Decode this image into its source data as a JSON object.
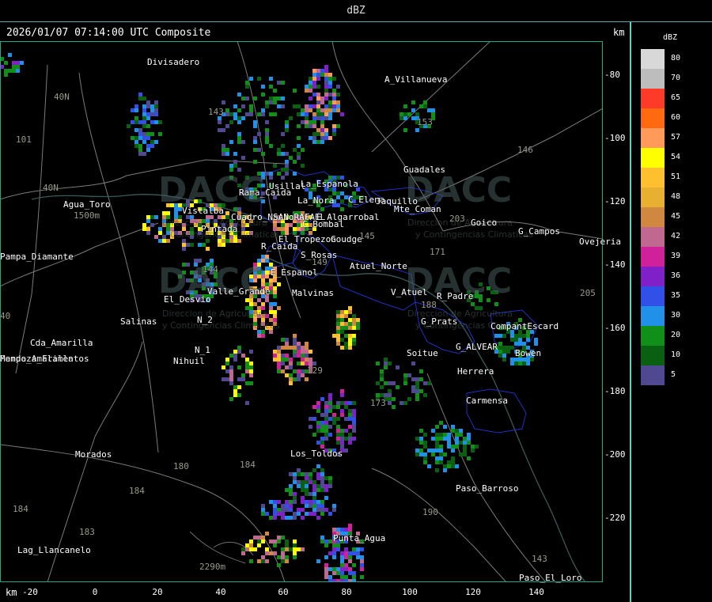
{
  "window": {
    "title": "dBZ"
  },
  "header": {
    "timestamp": "2026/01/07 07:14:00 UTC Composite",
    "unit_right": "km",
    "unit_bottom": "km"
  },
  "axes": {
    "y_ticks": [
      "-80",
      "-100",
      "-120",
      "-140",
      "-160",
      "-180",
      "-200",
      "-220"
    ],
    "x_ticks": [
      "-20",
      "0",
      "20",
      "40",
      "60",
      "80",
      "100",
      "120",
      "140"
    ]
  },
  "legend": {
    "title": "dBZ",
    "entries": [
      {
        "value": "80",
        "color": "#d8d8d8"
      },
      {
        "value": "70",
        "color": "#bdbdbd"
      },
      {
        "value": "65",
        "color": "#ff3a28"
      },
      {
        "value": "60",
        "color": "#ff6a10"
      },
      {
        "value": "57",
        "color": "#ff9a5a"
      },
      {
        "value": "54",
        "color": "#ffff00"
      },
      {
        "value": "51",
        "color": "#ffc030"
      },
      {
        "value": "48",
        "color": "#e8b030"
      },
      {
        "value": "45",
        "color": "#d08840"
      },
      {
        "value": "42",
        "color": "#c06890"
      },
      {
        "value": "39",
        "color": "#d0209a"
      },
      {
        "value": "36",
        "color": "#8020c8"
      },
      {
        "value": "35",
        "color": "#3050e8"
      },
      {
        "value": "30",
        "color": "#2090e8"
      },
      {
        "value": "20",
        "color": "#109018"
      },
      {
        "value": "10",
        "color": "#086010"
      },
      {
        "value": "5",
        "color": "#504890"
      }
    ]
  },
  "places": [
    {
      "name": "Divisadero",
      "dim": false
    },
    {
      "name": "A_Villanueva",
      "dim": false
    },
    {
      "name": "Guadales",
      "dim": false
    },
    {
      "name": "Vistalba",
      "dim": false
    },
    {
      "name": "Usillal",
      "dim": false
    },
    {
      "name": "La_Espanola",
      "dim": false
    },
    {
      "name": "C_Elena",
      "dim": false
    },
    {
      "name": "Jaquillo",
      "dim": false
    },
    {
      "name": "Mte_Coman",
      "dim": false
    },
    {
      "name": "Agua_Toro",
      "dim": false
    },
    {
      "name": "1500m",
      "dim": true
    },
    {
      "name": "Rama_Caida",
      "dim": false
    },
    {
      "name": "Cuadro_Nacional",
      "dim": false
    },
    {
      "name": "La_Nora",
      "dim": false
    },
    {
      "name": "SAN RAFAEL",
      "dim": false
    },
    {
      "name": "E_Algarrobal",
      "dim": false
    },
    {
      "name": "C_Bombal",
      "dim": false
    },
    {
      "name": "Goico",
      "dim": false
    },
    {
      "name": "G_Campos",
      "dim": false
    },
    {
      "name": "Ovejeria",
      "dim": false
    },
    {
      "name": "Pintada",
      "dim": false
    },
    {
      "name": "El_Tropezon",
      "dim": false
    },
    {
      "name": "Goudge",
      "dim": false
    },
    {
      "name": "Pampa_Diamante",
      "dim": false
    },
    {
      "name": "Pampa_Amarilla",
      "dim": false
    },
    {
      "name": "R_Caida",
      "dim": false
    },
    {
      "name": "S_Rosas",
      "dim": false
    },
    {
      "name": "Atuel_Norte",
      "dim": false
    },
    {
      "name": "E_Espanol",
      "dim": false
    },
    {
      "name": "El_Desvio",
      "dim": false
    },
    {
      "name": "Valle_Grande",
      "dim": false
    },
    {
      "name": "Malvinas",
      "dim": false
    },
    {
      "name": "V_Atuel",
      "dim": false
    },
    {
      "name": "R_Padre",
      "dim": false
    },
    {
      "name": "Salinas",
      "dim": false
    },
    {
      "name": "N_2",
      "dim": false
    },
    {
      "name": "G_Prats",
      "dim": false
    },
    {
      "name": "CompantEscard",
      "dim": false
    },
    {
      "name": "Cda_Amarilla",
      "dim": false
    },
    {
      "name": "Soitue",
      "dim": false
    },
    {
      "name": "G_ALVEAR",
      "dim": false
    },
    {
      "name": "Bowen",
      "dim": false
    },
    {
      "name": "N_1",
      "dim": false
    },
    {
      "name": "Nihuil",
      "dim": false
    },
    {
      "name": "Herrera",
      "dim": false
    },
    {
      "name": "Carmensa",
      "dim": false
    },
    {
      "name": "Morados",
      "dim": false
    },
    {
      "name": "Los_Toldos",
      "dim": false
    },
    {
      "name": "Paso_Barroso",
      "dim": false
    },
    {
      "name": "Lag_Llancanelo",
      "dim": false
    },
    {
      "name": "Punta_Agua",
      "dim": false
    },
    {
      "name": "2290m",
      "dim": true
    },
    {
      "name": "Paso_El_Loro",
      "dim": false
    },
    {
      "name": "Mendoza_Flamentos",
      "dim": false
    }
  ],
  "road_numbers": [
    "143",
    "153",
    "146",
    "101",
    "40N",
    "40N",
    "40",
    "145",
    "203",
    "171",
    "144",
    "129",
    "180",
    "184",
    "184",
    "183",
    "190",
    "184",
    "143",
    "205",
    "188",
    "173",
    "149"
  ],
  "watermark": {
    "brand": "DACC",
    "line1": "Direccion de Agricultura",
    "line2": "y Contingencias Climaticas"
  }
}
